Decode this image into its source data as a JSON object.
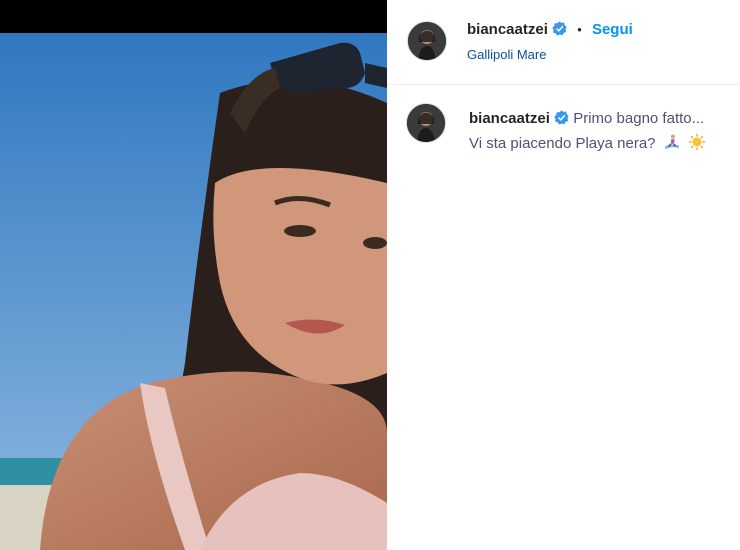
{
  "post": {
    "username": "biancaatzei",
    "follow_label": "Segui",
    "separator": "•",
    "location": "Gallipoli Mare",
    "caption_line1": "Primo bagno fatto...",
    "caption_line2": "Vi sta piacendo Playa nera?",
    "emojis": [
      "surfer-emoji",
      "sun-emoji"
    ]
  },
  "colors": {
    "follow": "#0095f6",
    "verified": "#3897f0",
    "sky": "#3f86c7",
    "sea": "#2f8fa3"
  }
}
